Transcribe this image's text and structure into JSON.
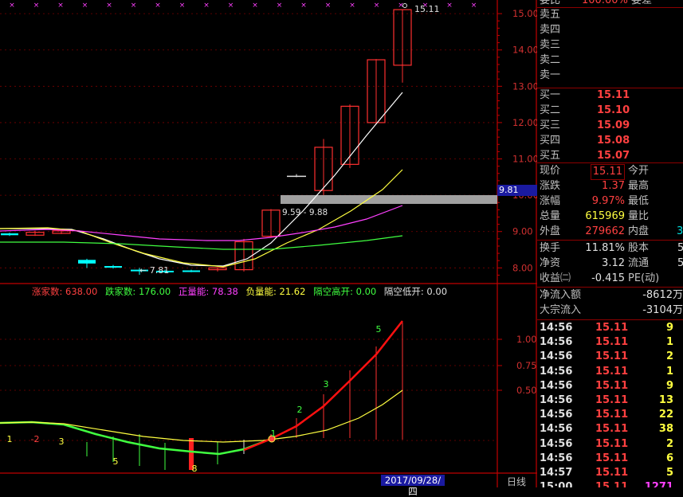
{
  "top_quote": {
    "label_cut": "委比",
    "value_cut": "100.00%",
    "diff_cut": "委差"
  },
  "sell_book": [
    {
      "label": "卖五"
    },
    {
      "label": "卖四"
    },
    {
      "label": "卖三"
    },
    {
      "label": "卖二"
    },
    {
      "label": "卖一"
    }
  ],
  "buy_book": [
    {
      "label": "买一",
      "price": "15.11"
    },
    {
      "label": "买二",
      "price": "15.10"
    },
    {
      "label": "买三",
      "price": "15.09"
    },
    {
      "label": "买四",
      "price": "15.08"
    },
    {
      "label": "买五",
      "price": "15.07"
    }
  ],
  "stats": {
    "now_label": "现价",
    "now": "15.11",
    "open_label": "今开",
    "chg_label": "涨跌",
    "chg": "1.37",
    "high_label": "最高",
    "pct_label": "涨幅",
    "pct": "9.97%",
    "low_label": "最低",
    "vol_label": "总量",
    "vol": "615969",
    "vr_label": "量比",
    "out_label": "外盘",
    "out": "279662",
    "in_label": "内盘",
    "in_cut": "3",
    "turn_label": "换手",
    "turn": "11.81%",
    "cap_label": "股本",
    "cap_cut": "5",
    "na_label": "净资",
    "na": "3.12",
    "float_label": "流通",
    "float_cut": "5",
    "eps_label": "收益㈡",
    "eps": "-0.415",
    "pe_label": "PE(动)"
  },
  "flows": {
    "net_label": "净流入额",
    "net": "-8612万",
    "big_label": "大宗流入",
    "big": "-3104万"
  },
  "ticks": [
    {
      "time": "14:56",
      "price": "15.11",
      "vol": "9"
    },
    {
      "time": "14:56",
      "price": "15.11",
      "vol": "1"
    },
    {
      "time": "14:56",
      "price": "15.11",
      "vol": "2"
    },
    {
      "time": "14:56",
      "price": "15.11",
      "vol": "1"
    },
    {
      "time": "14:56",
      "price": "15.11",
      "vol": "9"
    },
    {
      "time": "14:56",
      "price": "15.11",
      "vol": "13"
    },
    {
      "time": "14:56",
      "price": "15.11",
      "vol": "22"
    },
    {
      "time": "14:56",
      "price": "15.11",
      "vol": "38"
    },
    {
      "time": "14:56",
      "price": "15.11",
      "vol": "2"
    },
    {
      "time": "14:56",
      "price": "15.11",
      "vol": "6"
    },
    {
      "time": "14:57",
      "price": "15.11",
      "vol": "5"
    },
    {
      "time": "15:00",
      "price": "15.11",
      "vol": "1271"
    }
  ],
  "chart": {
    "price_axis": [
      "15.00",
      "14.00",
      "13.00",
      "12.00",
      "11.00",
      "10.00",
      "9.00",
      "8.00"
    ],
    "current_price_tag": "9.81",
    "high_label": "15.11",
    "low_label": "7.81",
    "range_label": "9.59 - 9.88",
    "indicator": {
      "up_label": "涨家数: 638.00",
      "down_label": "跌家数: 176.00",
      "pos_label": "正量能: 78.38",
      "neg_label": "负量能: 21.62",
      "gap_up_label": "隔空高开: 0.00",
      "gap_down_label": "隔空低开: 0.00"
    },
    "ind_axis": [
      "1.00",
      "0.75",
      "0.50"
    ],
    "wave_labels_left": [
      "1",
      "2",
      "3",
      "5",
      "8"
    ],
    "wave_labels_right": [
      "1",
      "2",
      "3",
      "5"
    ],
    "date": "2017/09/28/四",
    "period": "日线"
  },
  "chart_data": {
    "type": "candlestick",
    "price_ylim": [
      7.7,
      15.2
    ],
    "candles": [
      {
        "o": 8.95,
        "c": 8.9,
        "h": 8.97,
        "l": 8.88
      },
      {
        "o": 8.9,
        "c": 8.98,
        "h": 9.02,
        "l": 8.88
      },
      {
        "o": 8.95,
        "c": 9.02,
        "h": 9.08,
        "l": 8.93
      },
      {
        "o": 8.22,
        "c": 8.12,
        "h": 8.25,
        "l": 8.0
      },
      {
        "o": 8.05,
        "c": 8.03,
        "h": 8.08,
        "l": 7.98
      },
      {
        "o": 7.95,
        "c": 7.93,
        "h": 8.0,
        "l": 7.81
      },
      {
        "o": 7.92,
        "c": 7.9,
        "h": 7.95,
        "l": 7.88
      },
      {
        "o": 7.93,
        "c": 7.9,
        "h": 7.95,
        "l": 7.88
      },
      {
        "o": 7.95,
        "c": 8.0,
        "h": 8.02,
        "l": 7.9
      },
      {
        "o": 7.95,
        "c": 8.72,
        "h": 8.8,
        "l": 7.9
      },
      {
        "o": 8.87,
        "c": 9.59,
        "h": 9.62,
        "l": 8.85
      },
      {
        "o": 10.52,
        "c": 10.55,
        "h": 10.58,
        "l": 10.5
      },
      {
        "o": 10.13,
        "c": 11.32,
        "h": 11.55,
        "l": 10.0
      },
      {
        "o": 10.85,
        "c": 12.45,
        "h": 12.5,
        "l": 10.75
      },
      {
        "o": 12.0,
        "c": 13.73,
        "h": 13.75,
        "l": 11.98
      },
      {
        "o": 13.58,
        "c": 15.11,
        "h": 15.11,
        "l": 13.1
      }
    ]
  }
}
